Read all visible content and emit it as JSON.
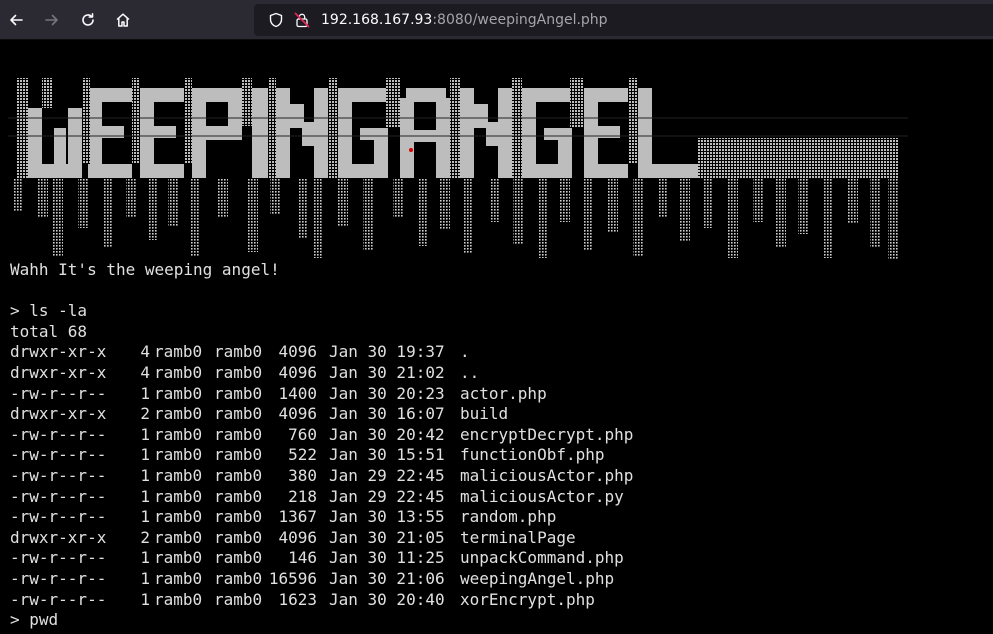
{
  "browser": {
    "url_host": "192.168.167.93",
    "url_rest": ":8080/weepingAngel.php",
    "icons": [
      "back-arrow-icon",
      "forward-arrow-icon",
      "reload-icon",
      "home-icon",
      "shield-icon",
      "insecure-lock-icon"
    ]
  },
  "page": {
    "banner_text": "WEEPINGANGEL",
    "greeting": "Wahh It's the weeping angel!",
    "blank": "",
    "command1": "> ls -la",
    "total": "total 68",
    "listing": [
      {
        "perm": "drwxr-xr-x",
        "links": "4",
        "user": "ramb0",
        "group": "ramb0",
        "size": "4096",
        "date": "Jan 30 19:37",
        "name": "."
      },
      {
        "perm": "drwxr-xr-x",
        "links": "4",
        "user": "ramb0",
        "group": "ramb0",
        "size": "4096",
        "date": "Jan 30 21:02",
        "name": ".."
      },
      {
        "perm": "-rw-r--r--",
        "links": "1",
        "user": "ramb0",
        "group": "ramb0",
        "size": "1400",
        "date": "Jan 30 20:23",
        "name": "actor.php"
      },
      {
        "perm": "drwxr-xr-x",
        "links": "2",
        "user": "ramb0",
        "group": "ramb0",
        "size": "4096",
        "date": "Jan 30 16:07",
        "name": "build"
      },
      {
        "perm": "-rw-r--r--",
        "links": "1",
        "user": "ramb0",
        "group": "ramb0",
        "size": "760",
        "date": "Jan 30 20:42",
        "name": "encryptDecrypt.php"
      },
      {
        "perm": "-rw-r--r--",
        "links": "1",
        "user": "ramb0",
        "group": "ramb0",
        "size": "522",
        "date": "Jan 30 15:51",
        "name": "functionObf.php"
      },
      {
        "perm": "-rw-r--r--",
        "links": "1",
        "user": "ramb0",
        "group": "ramb0",
        "size": "380",
        "date": "Jan 29 22:45",
        "name": "maliciousActor.php"
      },
      {
        "perm": "-rw-r--r--",
        "links": "1",
        "user": "ramb0",
        "group": "ramb0",
        "size": "218",
        "date": "Jan 29 22:45",
        "name": "maliciousActor.py"
      },
      {
        "perm": "-rw-r--r--",
        "links": "1",
        "user": "ramb0",
        "group": "ramb0",
        "size": "1367",
        "date": "Jan 30 13:55",
        "name": "random.php"
      },
      {
        "perm": "drwxr-xr-x",
        "links": "2",
        "user": "ramb0",
        "group": "ramb0",
        "size": "4096",
        "date": "Jan 30 21:05",
        "name": "terminalPage"
      },
      {
        "perm": "-rw-r--r--",
        "links": "1",
        "user": "ramb0",
        "group": "ramb0",
        "size": "146",
        "date": "Jan 30 11:25",
        "name": "unpackCommand.php"
      },
      {
        "perm": "-rw-r--r--",
        "links": "1",
        "user": "ramb0",
        "group": "ramb0",
        "size": "16596",
        "date": "Jan 30 21:06",
        "name": "weepingAngel.php"
      },
      {
        "perm": "-rw-r--r--",
        "links": "1",
        "user": "ramb0",
        "group": "ramb0",
        "size": "1623",
        "date": "Jan 30 20:40",
        "name": "xorEncrypt.php"
      }
    ],
    "command2": "> pwd"
  },
  "colors": {
    "toolbar_bg": "#2b2a33",
    "urlbar_bg": "#1c1b22",
    "terminal_bg": "#000000",
    "terminal_fg": "#e0e0e0",
    "banner_fill": "#bdbdbd",
    "insecure_lock": "#e22850"
  }
}
